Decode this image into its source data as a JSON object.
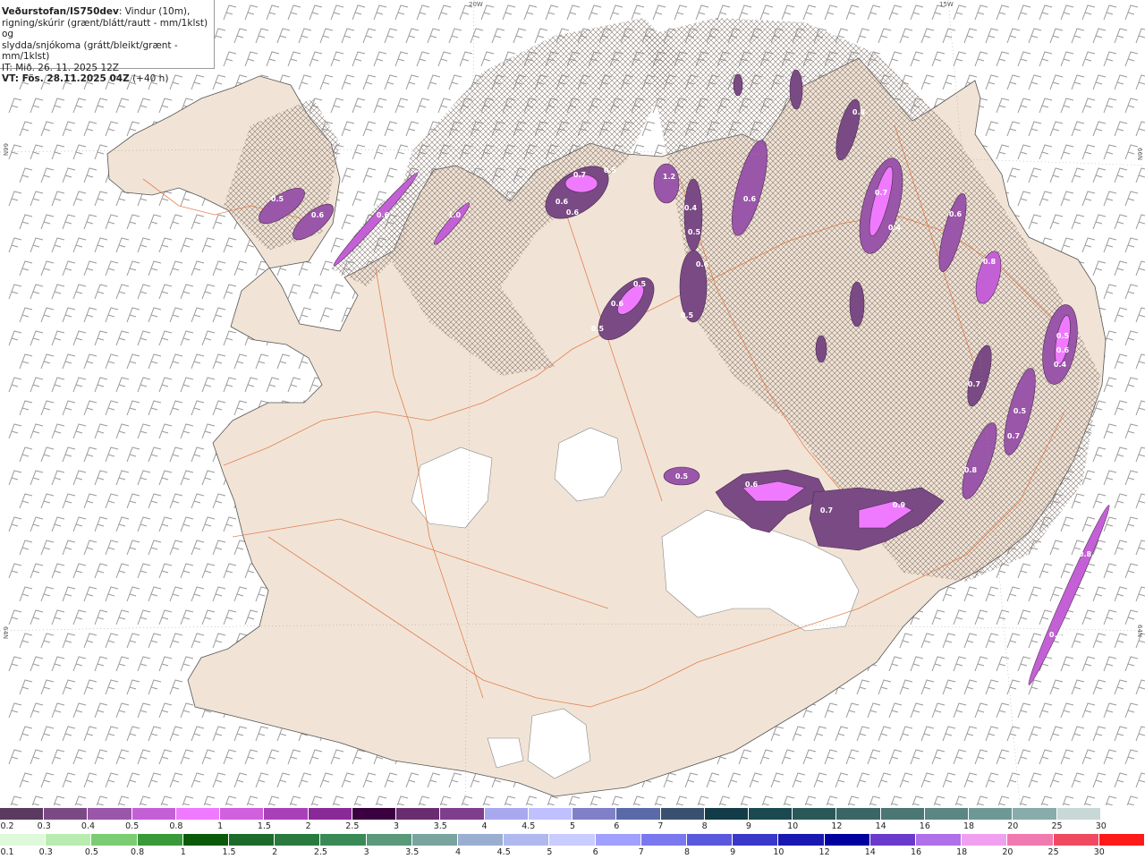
{
  "header": {
    "title": "Veðurstofan/IS750dev",
    "subtitle_1": ": Vindur (10m),",
    "line_2": "rigning/skúrir (grænt/blátt/rautt - mm/1klst) og",
    "line_3": "slydda/snjókoma (grátt/bleikt/grænt - mm/1klst)",
    "init_time": "IT: Mið. 26. 11. 2025 12Z",
    "valid_time": "VT: Fös. 28.11.2025 04Z",
    "lead": "(+40 h)"
  },
  "map_labels": {
    "lon_20w": "20W",
    "lon_15w": "15W",
    "lat_66n_left": "66N",
    "lat_66n_right": "66N",
    "lat_64n_left": "64N",
    "lat_64n_right": "64N"
  },
  "snow_scale": {
    "labels": [
      "0.2",
      "0.3",
      "0.4",
      "0.5",
      "0.8",
      "1",
      "1.5",
      "2",
      "2.5",
      "3",
      "3.5",
      "4",
      "4.5",
      "5",
      "6",
      "7",
      "8",
      "9",
      "10",
      "12",
      "14",
      "16",
      "18",
      "20",
      "25",
      "30"
    ],
    "colors": [
      "#5a3a5e",
      "#7a4a84",
      "#9a56a8",
      "#c460d6",
      "#f07aff",
      "#d060de",
      "#aa40b8",
      "#8a2a98",
      "#3a0040",
      "#6a2c70",
      "#7e3e8c",
      "#a8a8ee",
      "#c0c0ff",
      "#8080c8",
      "#5a6aa8",
      "#3a5070",
      "#123c48",
      "#1a4a50",
      "#2a5858",
      "#3a6666",
      "#4a7674",
      "#5a8684",
      "#6e9896",
      "#88acaa",
      "#c8d8d6",
      "#ffffff"
    ]
  },
  "rain_scale": {
    "labels": [
      "0.1",
      "0.3",
      "0.5",
      "0.8",
      "1",
      "1.5",
      "2",
      "2.5",
      "3",
      "3.5",
      "4",
      "4.5",
      "5",
      "6",
      "7",
      "8",
      "9",
      "10",
      "12",
      "14",
      "16",
      "18",
      "20",
      "25",
      "30"
    ],
    "colors": [
      "#e0f8dc",
      "#b8ecb0",
      "#7ccc74",
      "#3a9a3a",
      "#0a5a0a",
      "#1e6a2a",
      "#2a7a40",
      "#3a8a58",
      "#5a9a7a",
      "#7aa4a0",
      "#9aaed0",
      "#b0b8f0",
      "#c8ccff",
      "#a0a0ff",
      "#7a78ee",
      "#5a58dc",
      "#3a38c8",
      "#1a18b0",
      "#0000a0",
      "#6a3acc",
      "#b070e8",
      "#f0a0f0",
      "#f07ab0",
      "#f04a60",
      "#ff1a1a"
    ]
  },
  "precip_labels": [
    "0.5",
    "0.6",
    "0.6",
    "1.0",
    "0.6",
    "0.7",
    "0.5",
    "0.6",
    "0.5",
    "0.6",
    "0.5",
    "1.2",
    "0.4",
    "0.5",
    "0.6",
    "0.5",
    "0.6",
    "0.8",
    "0.7",
    "0.4",
    "0.6",
    "0.8",
    "0.7",
    "0.7",
    "0.5",
    "0.6",
    "0.4",
    "0.5",
    "0.8",
    "0.9",
    "0.7",
    "0.6",
    "0.5",
    "0.8",
    "0.6"
  ]
}
